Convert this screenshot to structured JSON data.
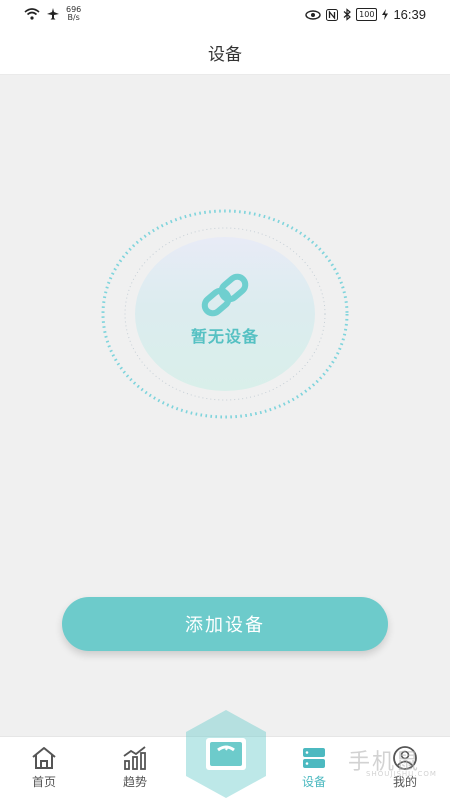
{
  "status_bar": {
    "net_speed_value": "696",
    "net_speed_unit": "B/s",
    "battery": "100",
    "time": "16:39",
    "icons": [
      "wifi-icon",
      "airplane-icon",
      "eye-icon",
      "nfc-icon",
      "bluetooth-icon",
      "battery-icon",
      "charging-icon"
    ]
  },
  "header": {
    "title": "设备"
  },
  "empty_state": {
    "text": "暂无设备",
    "icon": "link-icon"
  },
  "add_button": {
    "label": "添加设备"
  },
  "bottom_nav": {
    "items": [
      {
        "label": "首页",
        "icon": "home-icon",
        "active": false
      },
      {
        "label": "趋势",
        "icon": "trend-icon",
        "active": false
      },
      {
        "label": "",
        "icon": "scale-icon",
        "active": false
      },
      {
        "label": "设备",
        "icon": "device-icon",
        "active": true
      },
      {
        "label": "我的",
        "icon": "profile-icon",
        "active": false
      }
    ]
  },
  "watermark": {
    "text": "手机鼠",
    "sub": "SHOUJISHU.COM"
  },
  "colors": {
    "accent": "#6dcbcb",
    "accent_text": "#56c1c3",
    "background": "#f0f0f0"
  }
}
